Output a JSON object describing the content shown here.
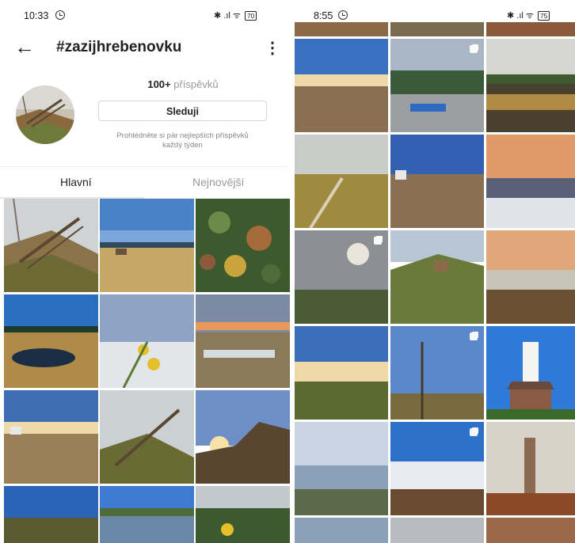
{
  "left_screen": {
    "status_bar": {
      "time": "10:33",
      "icons": "✱ .ıl ᯤ",
      "battery": "70"
    },
    "header": {
      "back_icon": "arrow-left-icon",
      "title": "#zazijhrebenovku",
      "menu_icon": "more-vertical-icon"
    },
    "profile": {
      "posts_count": "100+",
      "posts_label": "příspěvků",
      "follow_label": "Sleduji",
      "description_line1": "Prohlédněte si pár nejlepších příspěvků",
      "description_line2": "každý týden"
    },
    "tabs": [
      {
        "label": "Hlavní",
        "selected": true
      },
      {
        "label": "Nejnovější",
        "selected": false
      }
    ]
  },
  "right_screen": {
    "status_bar": {
      "time": "8:55",
      "icons": "✱ .ıl ᯤ",
      "battery": "75"
    }
  },
  "colors": {
    "text": "#222222",
    "muted": "#999999",
    "border": "#d5d5d5"
  }
}
